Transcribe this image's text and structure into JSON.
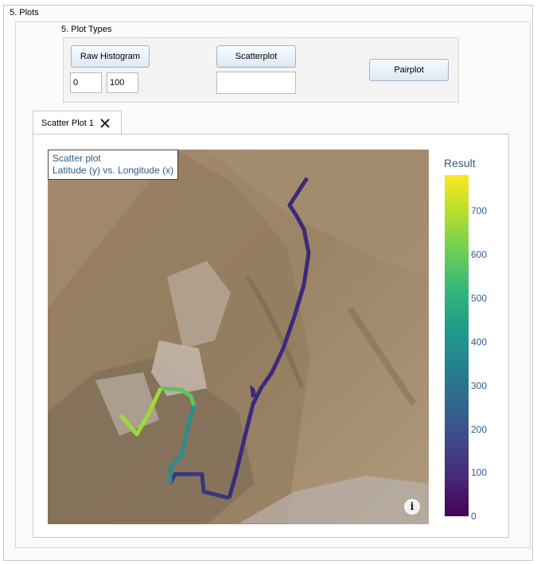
{
  "section": {
    "title": "5. Plots"
  },
  "plot_types": {
    "title": "5. Plot Types",
    "raw_histogram_label": "Raw Histogram",
    "range_min": "0",
    "range_max": "100",
    "scatterplot_label": "Scatterplot",
    "scatter_input": "",
    "pairplot_label": "Pairplot"
  },
  "tab": {
    "label": "Scatter Plot 1"
  },
  "plot": {
    "legend_title": "Scatter plot",
    "legend_subtitle": "Latitude (y) vs. Longitude (x)",
    "colorbar_title": "Result",
    "colorbar_ticks": [
      "700",
      "600",
      "500",
      "400",
      "300",
      "200",
      "100",
      "0"
    ],
    "info_glyph": "i"
  },
  "colors": {
    "track_low": "#3b2a7a",
    "track_high": "#b5de2b",
    "map_base": "#a0896a"
  }
}
